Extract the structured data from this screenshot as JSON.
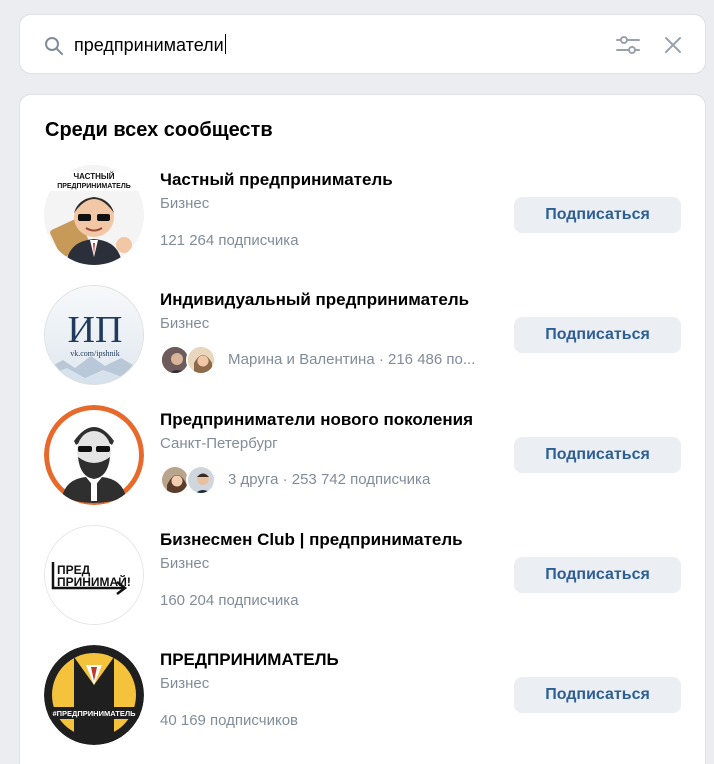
{
  "search": {
    "query": "предприниматели"
  },
  "panel": {
    "title": "Среди всех сообществ"
  },
  "communities": [
    {
      "name": "Частный предприниматель",
      "category": "Бизнес",
      "meta": "121 264 подписчика",
      "button": "Подписаться",
      "avatar_text": "ЧАСТНЫЙ ПРЕДПРИНИМАТЕЛЬ"
    },
    {
      "name": "Индивидуальный предприниматель",
      "category": "Бизнес",
      "meta": "Марина и Валентина · 216 486 по...",
      "button": "Подписаться",
      "avatar_text": "ИП",
      "avatar_subtext": "vk.com/ipshnik"
    },
    {
      "name": "Предприниматели нового поколения",
      "category": "Санкт-Петербург",
      "meta": "3 друга · 253 742 подписчика",
      "button": "Подписаться"
    },
    {
      "name": "Бизнесмен Club | предприниматель",
      "category": "Бизнес",
      "meta": "160 204 подписчика",
      "button": "Подписаться",
      "avatar_text_line1": "ПРЕД",
      "avatar_text_line2": "ПРИНИМАЙ!"
    },
    {
      "name": "ПРЕДПРИНИМАТЕЛЬ",
      "category": "Бизнес",
      "meta": "40 169 подписчиков",
      "button": "Подписаться",
      "avatar_text": "#ПРЕДПРИНИМАТЕЛЬ"
    }
  ],
  "colors": {
    "background": "#ebedf0",
    "button_bg": "#ebeef2",
    "button_text": "#2d5e94",
    "secondary_text": "#818c99"
  }
}
